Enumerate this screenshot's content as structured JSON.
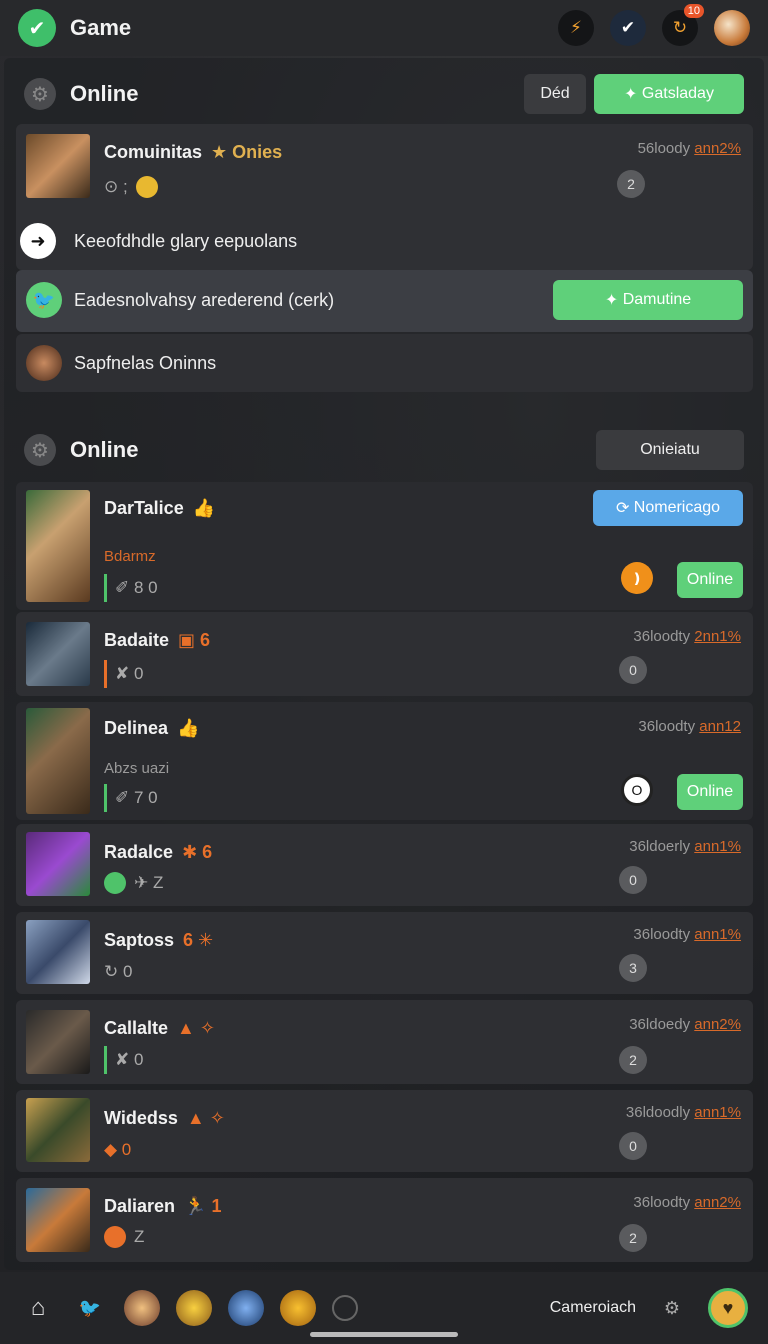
{
  "app": {
    "title": "Game",
    "notification_count": "10",
    "icons": [
      "checkmark-logo",
      "lightning-icon",
      "checkmark-icon",
      "refresh-icon",
      "profile-avatar"
    ]
  },
  "section1": {
    "title": "Online",
    "btn_secondary": "Déd",
    "btn_primary": "Gatsladay"
  },
  "featured": {
    "name": "Comuinitas",
    "flair": "★ Onies",
    "right_text": "56loody",
    "right_link": "ann2%",
    "meta_counts": "⊙ ;",
    "circle": "2"
  },
  "rows": [
    {
      "text": "Keeofdhdle glary eepuolans",
      "icon": "arrow-right-icon"
    },
    {
      "text": "Eadesnolvahsy arederend (cerk)",
      "icon": "bird-icon",
      "button": "Damutine"
    },
    {
      "text": "Sapfnelas Oninns",
      "icon": "avatar"
    }
  ],
  "section2": {
    "title": "Online",
    "btn": "Onieiatu"
  },
  "players": [
    {
      "name": "DarTalice",
      "flair": "👍",
      "sub": "Bdarmz",
      "meta": "✐ 8 0",
      "badge_button": "Nomericago",
      "circle": "❫",
      "online": "Online"
    },
    {
      "name": "Badaite",
      "flair": "▣ 6",
      "meta": "✘ 0",
      "right_text": "36loodty",
      "right_link": "2nn1%",
      "circle": "0"
    },
    {
      "name": "Delinea",
      "flair": "👍",
      "sub": "Abzs uazi",
      "meta": "✐ 7 0",
      "right_text": "36loodty",
      "right_link": "ann12",
      "circle": "O",
      "online": "Online"
    },
    {
      "name": "Radalce",
      "flair": "✱ 6",
      "meta": "✈ Z",
      "right_text": "36ldoerly",
      "right_link": "ann1%",
      "circle": "0"
    },
    {
      "name": "Saptoss",
      "flair": "6 ✳",
      "meta": "↻ 0",
      "right_text": "36loodty",
      "right_link": "ann1%",
      "circle": "3"
    },
    {
      "name": "Callalte",
      "flair": "▲ ✧",
      "meta": "✘ 0",
      "right_text": "36ldoedy",
      "right_link": "ann2%",
      "circle": "2"
    },
    {
      "name": "Widedss",
      "flair": "▲ ✧",
      "meta": "◆ 0",
      "right_text": "36ldoodly",
      "right_link": "ann1%",
      "circle": "0"
    },
    {
      "name": "Daliaren",
      "flair": "🏃 1",
      "meta": "Z",
      "right_text": "36loodty",
      "right_link": "ann2%",
      "circle": "2"
    }
  ],
  "bottom": {
    "label": "Cameroiach"
  }
}
